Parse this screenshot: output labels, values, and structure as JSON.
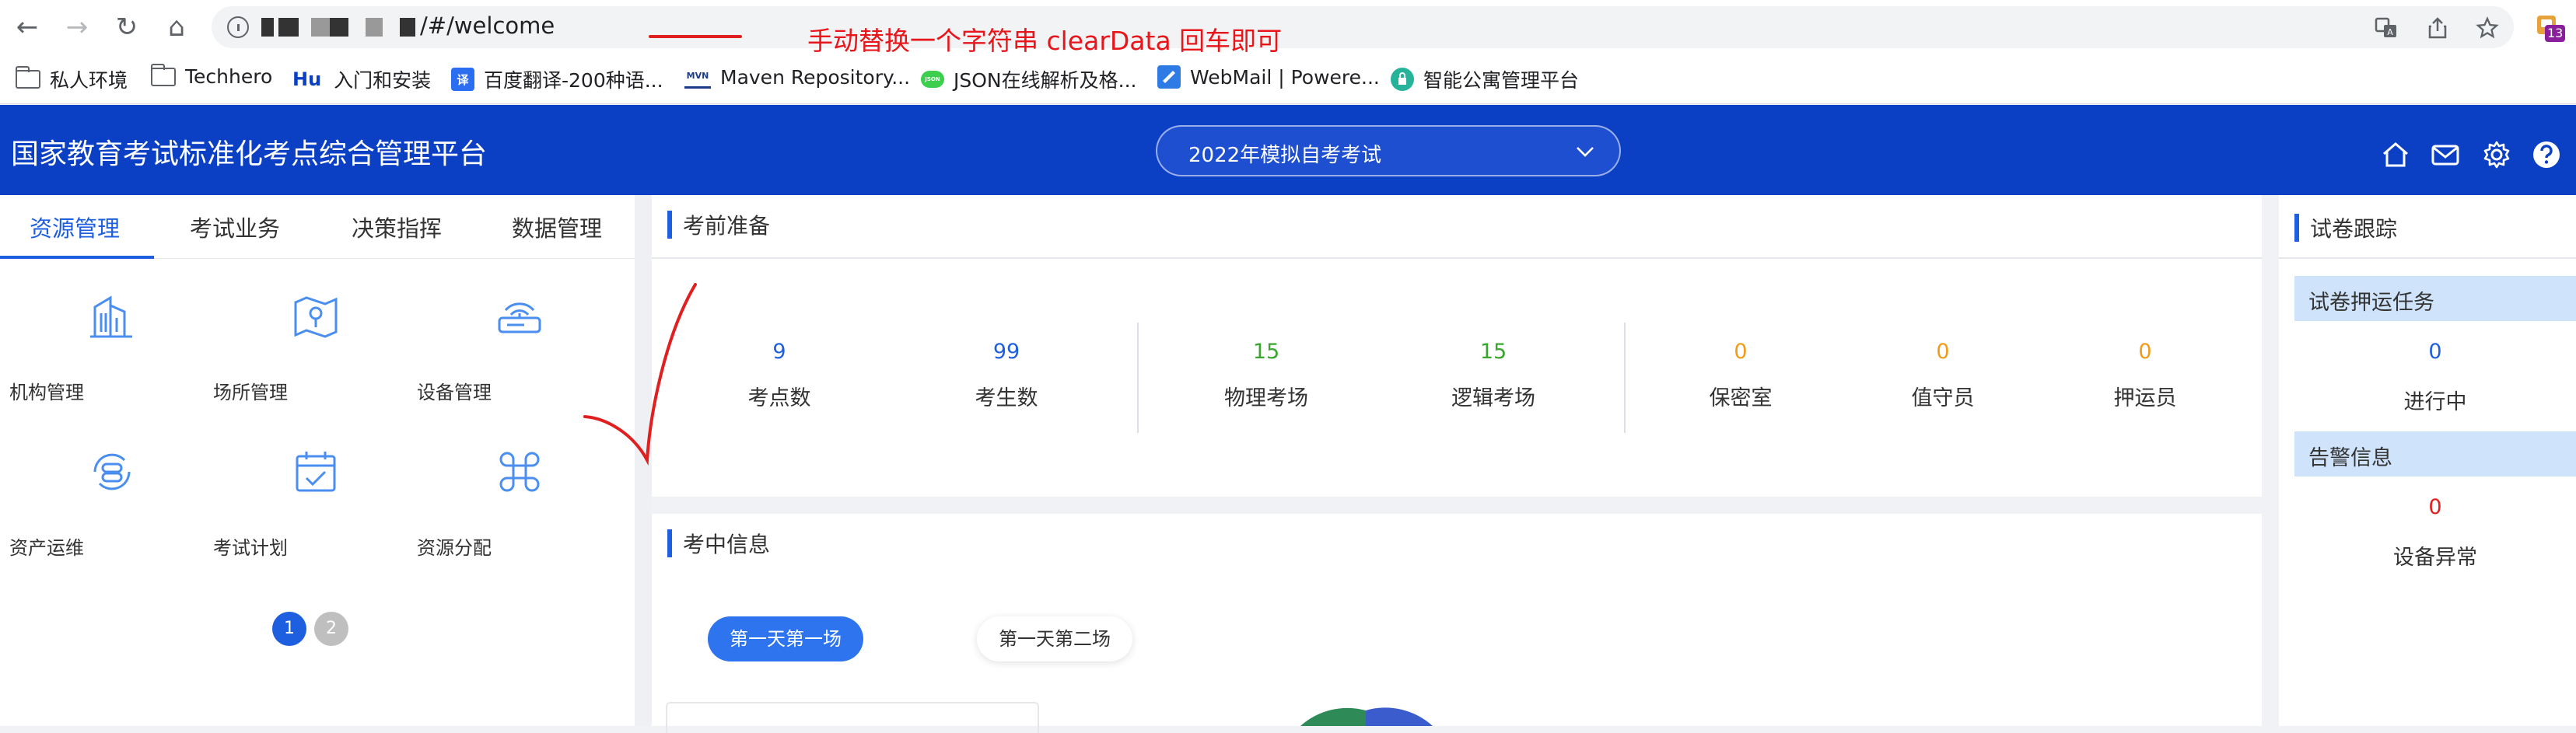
{
  "browser": {
    "url_suffix": "/#/welcome",
    "annotation": "手动替换一个字符串   clearData  回车即可",
    "extension_badge": "13",
    "bookmarks": [
      {
        "label": "私人环境",
        "icon": "folder-icon"
      },
      {
        "label": "Techhero",
        "icon": "folder-icon"
      },
      {
        "label": "入门和安装",
        "icon": "hu-icon",
        "icon_text": "Hu"
      },
      {
        "label": "百度翻译-200种语...",
        "icon": "translate-icon",
        "icon_text": "译"
      },
      {
        "label": "Maven Repository...",
        "icon": "mvn-icon",
        "icon_text": "MVN"
      },
      {
        "label": "JSON在线解析及格...",
        "icon": "json-icon",
        "icon_text": "JSON"
      },
      {
        "label": "WebMail | Powere...",
        "icon": "webmail-icon"
      },
      {
        "label": "智能公寓管理平台",
        "icon": "apartment-icon"
      }
    ]
  },
  "header": {
    "title": "国家教育考试标准化考点综合管理平台",
    "exam_select": "2022年模拟自考考试",
    "brand_color": "#0b3fc4"
  },
  "left": {
    "tabs": [
      "资源管理",
      "考试业务",
      "决策指挥",
      "数据管理"
    ],
    "items": [
      {
        "label": "机构管理",
        "icon": "building-icon"
      },
      {
        "label": "场所管理",
        "icon": "map-pin-icon"
      },
      {
        "label": "设备管理",
        "icon": "router-icon"
      },
      {
        "label": "资产运维",
        "icon": "maintenance-icon"
      },
      {
        "label": "考试计划",
        "icon": "calendar-icon"
      },
      {
        "label": "资源分配",
        "icon": "grid-icon"
      }
    ],
    "pages": [
      "1",
      "2"
    ]
  },
  "prep": {
    "title": "考前准备",
    "stats": [
      {
        "value": "9",
        "label": "考点数",
        "color": "#1e5fe0"
      },
      {
        "value": "99",
        "label": "考生数",
        "color": "#1e5fe0"
      },
      {
        "value": "15",
        "label": "物理考场",
        "color": "#3aa52e"
      },
      {
        "value": "15",
        "label": "逻辑考场",
        "color": "#3aa52e"
      },
      {
        "value": "0",
        "label": "保密室",
        "color": "#f29b18"
      },
      {
        "value": "0",
        "label": "值守员",
        "color": "#f29b18"
      },
      {
        "value": "0",
        "label": "押运员",
        "color": "#f29b18"
      }
    ]
  },
  "during": {
    "title": "考中信息",
    "sessions": [
      "第一天第一场",
      "第一天第二场"
    ]
  },
  "right": {
    "title": "试卷跟踪",
    "escort_title": "试卷押运任务",
    "escort_value": "0",
    "escort_label": "进行中",
    "alert_title": "告警信息",
    "alert_value": "0",
    "alert_label": "设备异常"
  }
}
